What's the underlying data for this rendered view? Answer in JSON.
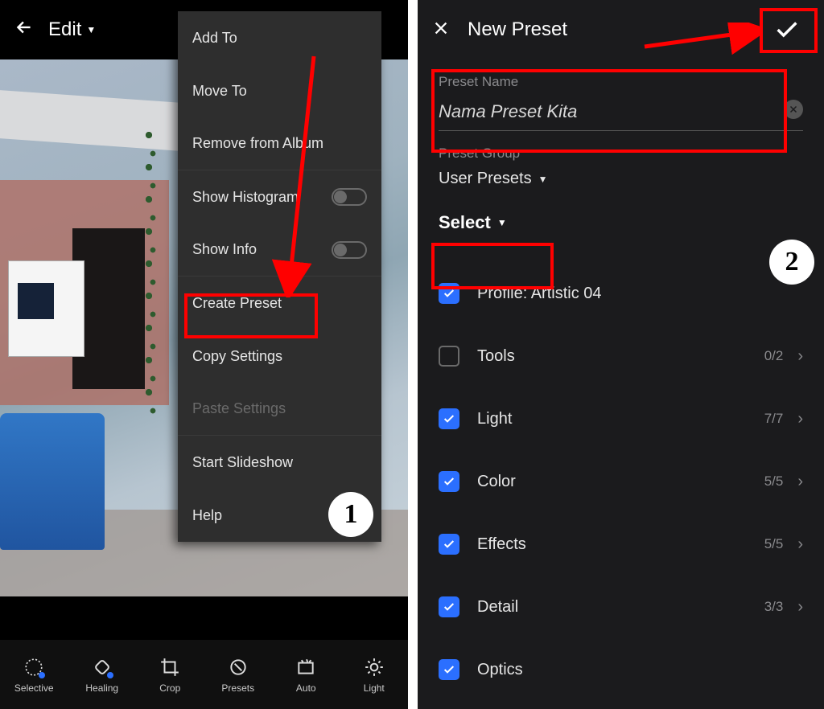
{
  "left": {
    "header_title": "Edit",
    "menu": {
      "add_to": "Add To",
      "move_to": "Move To",
      "remove_album": "Remove from Album",
      "show_histogram": "Show Histogram",
      "show_info": "Show Info",
      "create_preset": "Create Preset",
      "copy_settings": "Copy Settings",
      "paste_settings": "Paste Settings",
      "start_slideshow": "Start Slideshow",
      "help": "Help"
    },
    "toolbar": {
      "selective": "Selective",
      "healing": "Healing",
      "crop": "Crop",
      "presets": "Presets",
      "auto": "Auto",
      "light": "Light"
    }
  },
  "right": {
    "title": "New Preset",
    "preset_name_label": "Preset Name",
    "preset_name_value": "Nama Preset Kita",
    "preset_group_label": "Preset Group",
    "preset_group_value": "User Presets",
    "select_label": "Select",
    "rows": {
      "profile": "Profile: Artistic 04",
      "tools": "Tools",
      "tools_count": "0/2",
      "light": "Light",
      "light_count": "7/7",
      "color": "Color",
      "color_count": "5/5",
      "effects": "Effects",
      "effects_count": "5/5",
      "detail": "Detail",
      "detail_count": "3/3",
      "optics": "Optics"
    }
  },
  "annotations": {
    "badge1": "1",
    "badge2": "2"
  }
}
